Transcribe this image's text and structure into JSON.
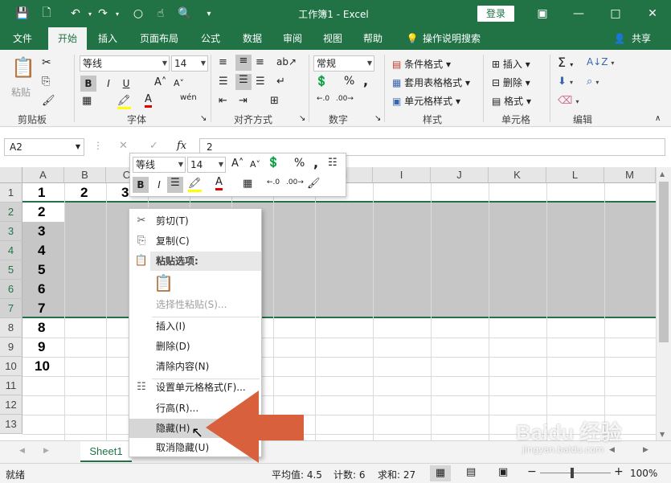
{
  "titlebar": {
    "title": "工作簿1  -  Excel",
    "login": "登录",
    "min_icon": "minimize-icon",
    "restore_icon": "restore-icon",
    "close_icon": "close-icon"
  },
  "tabs": [
    "文件",
    "开始",
    "插入",
    "页面布局",
    "公式",
    "数据",
    "审阅",
    "视图",
    "帮助"
  ],
  "tell_me": "操作说明搜索",
  "share": "共享",
  "ribbon": {
    "clipboard": {
      "label": "剪贴板",
      "paste": "粘贴"
    },
    "font": {
      "label": "字体",
      "family": "等线",
      "size": "14",
      "bold": "B",
      "italic": "I",
      "underline": "U"
    },
    "alignment": {
      "label": "对齐方式"
    },
    "number": {
      "label": "数字",
      "format": "常规",
      "percent": "%",
      "comma": ","
    },
    "styles": {
      "label": "样式",
      "conditional": "条件格式",
      "table": "套用表格格式",
      "cell": "单元格样式"
    },
    "cells": {
      "label": "单元格",
      "insert": "插入",
      "delete": "删除",
      "format": "格式"
    },
    "editing": {
      "label": "编辑"
    }
  },
  "formula_bar": {
    "name_box": "A2",
    "fx": "fx",
    "value": "2"
  },
  "columns": [
    "A",
    "B",
    "C",
    "D",
    "E",
    "F",
    "G",
    "H",
    "I",
    "J",
    "K",
    "L",
    "M"
  ],
  "rows": [
    "1",
    "2",
    "3",
    "4",
    "5",
    "6",
    "7",
    "8",
    "9",
    "10",
    "11",
    "12",
    "13"
  ],
  "cells": {
    "row1": [
      "1",
      "2",
      "3"
    ],
    "colA": [
      "2",
      "3",
      "4",
      "5",
      "6",
      "7",
      "8",
      "9",
      "10"
    ]
  },
  "mini_toolbar": {
    "font": "等线",
    "size": "14",
    "bold": "B",
    "italic": "I",
    "percent": "%",
    "comma": ","
  },
  "context_menu": {
    "cut": "剪切(T)",
    "copy": "复制(C)",
    "paste_options": "粘贴选项:",
    "paste_special": "选择性粘贴(S)...",
    "insert": "插入(I)",
    "delete": "删除(D)",
    "clear": "清除内容(N)",
    "format_cells": "设置单元格格式(F)...",
    "row_height": "行高(R)...",
    "hide": "隐藏(H)",
    "unhide": "取消隐藏(U)"
  },
  "sheet_tab": "Sheet1",
  "status": {
    "ready": "就绪",
    "average": "平均值: 4.5",
    "count": "计数: 6",
    "sum": "求和: 27",
    "zoom": "100%"
  },
  "watermark": "Baidu 经验",
  "watermark_url": "jingyan.baidu.com",
  "colors": {
    "excel_green": "#217346",
    "arrow": "#d9603c",
    "selection": "#c6c6c6"
  }
}
